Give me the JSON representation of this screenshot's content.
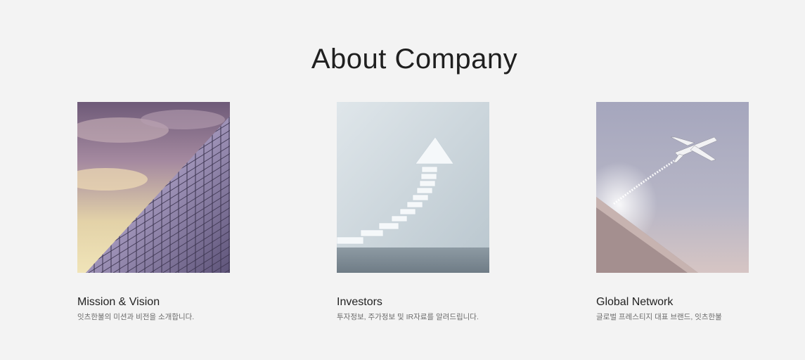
{
  "section": {
    "title": "About Company"
  },
  "cards": [
    {
      "heading": "Mission & Vision",
      "description": "잇츠한불의 미션과 비전을 소개합니다.",
      "image_icon": "glass-building-image"
    },
    {
      "heading": "Investors",
      "description": "투자정보, 주가정보 및 IR자료를 알려드립니다.",
      "image_icon": "stairs-arrow-image"
    },
    {
      "heading": "Global Network",
      "description": "글로벌 프레스티지 대표 브랜드, 잇츠한불",
      "image_icon": "airplane-image"
    }
  ],
  "colors": {
    "background": "#f3f3f3",
    "heading": "#222222",
    "description": "#6b6b6b"
  }
}
